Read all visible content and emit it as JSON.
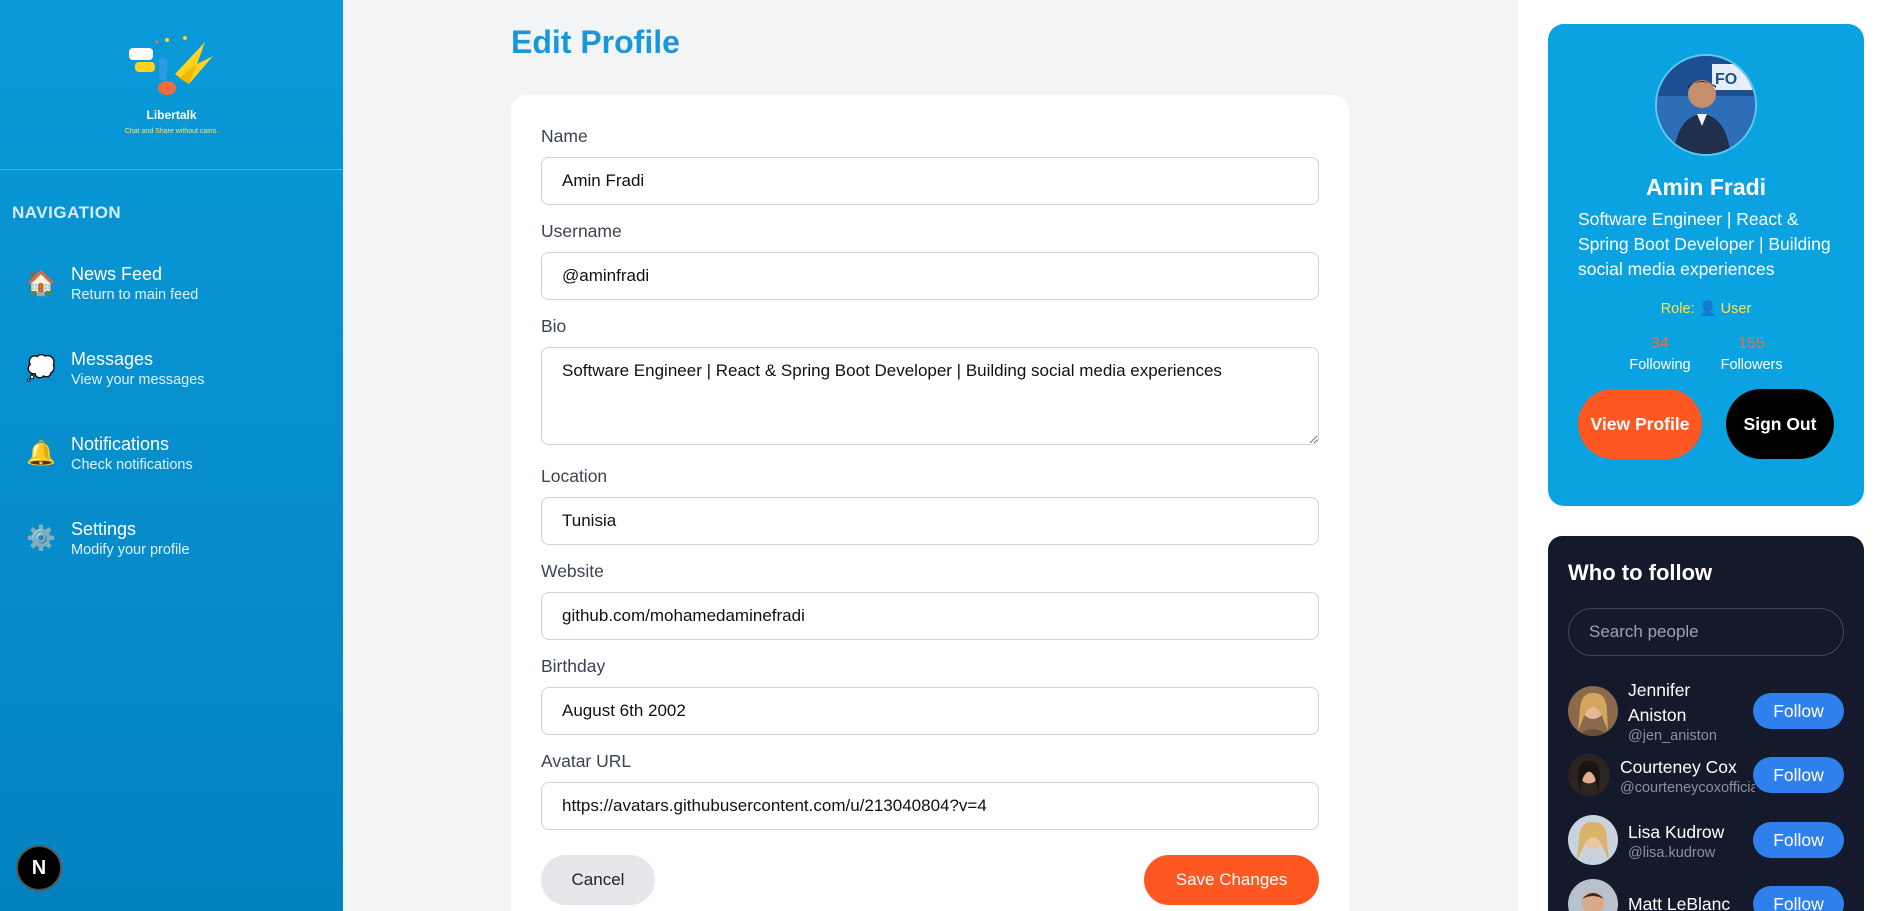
{
  "brand": {
    "name": "Libertalk",
    "tagline": "Chat and Share without cains."
  },
  "nav": {
    "heading": "NAVIGATION",
    "items": [
      {
        "title": "News Feed",
        "subtitle": "Return to main feed",
        "icon": "house-icon"
      },
      {
        "title": "Messages",
        "subtitle": "View your messages",
        "icon": "speech-bubble-icon"
      },
      {
        "title": "Notifications",
        "subtitle": "Check notifications",
        "icon": "bell-icon"
      },
      {
        "title": "Settings",
        "subtitle": "Modify your profile",
        "icon": "gear-icon"
      }
    ],
    "badge": "N"
  },
  "form": {
    "title": "Edit Profile",
    "fields": {
      "name": {
        "label": "Name",
        "value": "Amin Fradi"
      },
      "username": {
        "label": "Username",
        "value": "@aminfradi"
      },
      "bio": {
        "label": "Bio",
        "value": "Software Engineer | React & Spring Boot Developer | Building social media experiences"
      },
      "location": {
        "label": "Location",
        "value": "Tunisia"
      },
      "website": {
        "label": "Website",
        "value": "github.com/mohamedaminefradi"
      },
      "birthday": {
        "label": "Birthday",
        "value": "August 6th 2002"
      },
      "avatar_url": {
        "label": "Avatar URL",
        "value": "https://avatars.githubusercontent.com/u/213040804?v=4"
      }
    },
    "cancel_label": "Cancel",
    "save_label": "Save Changes"
  },
  "profile": {
    "name": "Amin Fradi",
    "bio": "Software Engineer | React & Spring Boot Developer | Building social media experiences",
    "role_label": "Role:",
    "role_value": "User",
    "following_count": "34",
    "following_label": "Following",
    "followers_count": "155",
    "followers_label": "Followers",
    "view_profile_label": "View Profile",
    "sign_out_label": "Sign Out"
  },
  "who_to_follow": {
    "title": "Who to follow",
    "search_placeholder": "Search people",
    "follow_label": "Follow",
    "people": [
      {
        "name": "Jennifer Aniston",
        "handle": "@jen_aniston"
      },
      {
        "name": "Courteney Cox",
        "handle": "@courteneycoxofficial"
      },
      {
        "name": "Lisa Kudrow",
        "handle": "@lisa.kudrow"
      },
      {
        "name": "Matt LeBlanc",
        "handle": ""
      }
    ]
  },
  "colors": {
    "sidebar": "#0a9ad9",
    "title_blue": "#1a97d8",
    "accent_orange": "#ff5722",
    "follow_blue": "#2f80ed",
    "dark_card": "#141a2b"
  }
}
